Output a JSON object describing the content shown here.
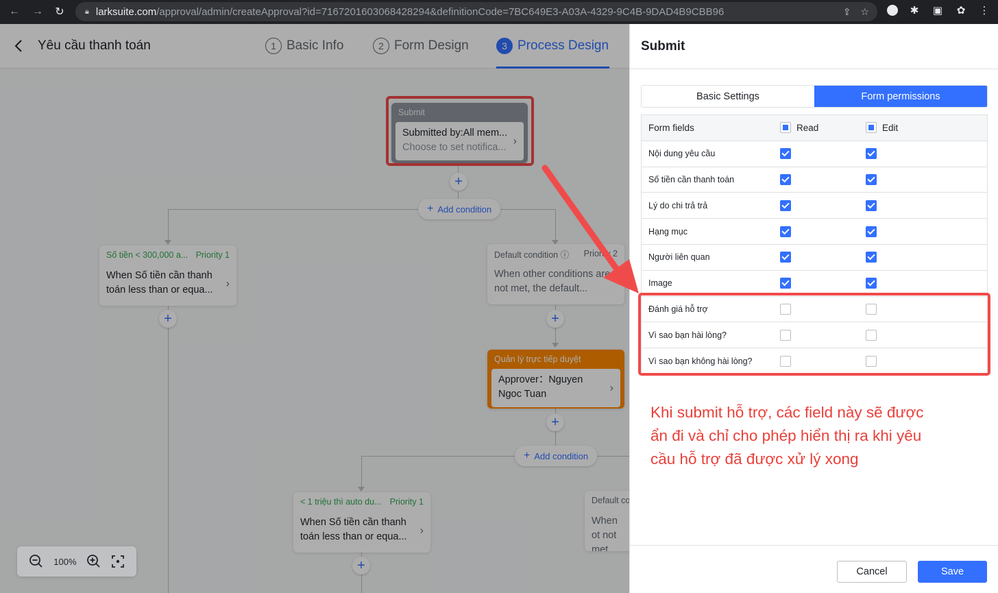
{
  "browser": {
    "url_domain": "larksuite.com",
    "url_path": "/approval/admin/createApproval?id=7167201603068428294&definitionCode=7BC649E3-A03A-4329-9C4B-9DAD4B9CBB96"
  },
  "header": {
    "title": "Yêu cầu thanh toán",
    "steps": [
      {
        "num": "1",
        "label": "Basic Info"
      },
      {
        "num": "2",
        "label": "Form Design"
      },
      {
        "num": "3",
        "label": "Process Design"
      }
    ]
  },
  "canvas": {
    "submit_node": {
      "head": "Submit",
      "line1": "Submitted by:All mem...",
      "line2": "Choose to set notifica..."
    },
    "add_condition": "Add condition",
    "cond1": {
      "head": "Số tiền < 300,000 a...",
      "priority": "Priority 1",
      "body": "When Số tiền cần thanh toán less than or equa..."
    },
    "default1": {
      "head": "Default condition ⓘ",
      "priority": "Priority 2",
      "body": "When other conditions are not met, the default..."
    },
    "approver": {
      "head": "Quản lý trực tiếp duyệt",
      "body": "Approver：Nguyen Ngoc Tuan"
    },
    "cond2": {
      "head": "< 1 triệu thì auto du...",
      "priority": "Priority 1",
      "body": "When Số tiền cần thanh toán less than or equa..."
    },
    "default2": {
      "head": "Default co",
      "body": "When ot not met,"
    },
    "zoom": "100%"
  },
  "panel": {
    "title": "Submit",
    "tabs": [
      "Basic Settings",
      "Form permissions"
    ],
    "table_head": {
      "field": "Form fields",
      "read": "Read",
      "edit": "Edit"
    },
    "rows": [
      {
        "field": "Nội dung yêu cầu",
        "read": true,
        "edit": true
      },
      {
        "field": "Số tiền cần thanh toán",
        "read": true,
        "edit": true
      },
      {
        "field": "Lý do chi trả trả",
        "read": true,
        "edit": true
      },
      {
        "field": "Hạng mục",
        "read": true,
        "edit": true
      },
      {
        "field": "Người liên quan",
        "read": true,
        "edit": true
      },
      {
        "field": "Image",
        "read": true,
        "edit": true
      },
      {
        "field": "Đánh giá hỗ trợ",
        "read": false,
        "edit": false
      },
      {
        "field": "Vì sao bạn hài lòng?",
        "read": false,
        "edit": false
      },
      {
        "field": "Vì sao bạn không hài lòng?",
        "read": false,
        "edit": false
      }
    ],
    "annotation": "Khi submit hỗ trợ, các field này sẽ được ẩn đi và chỉ cho phép hiển thị ra khi yêu cầu hỗ trợ đã được xử lý xong",
    "cancel": "Cancel",
    "save": "Save"
  },
  "colors": {
    "accent": "#3370ff",
    "annotation_red": "#f04b4b",
    "approver_orange": "#ff8800"
  }
}
